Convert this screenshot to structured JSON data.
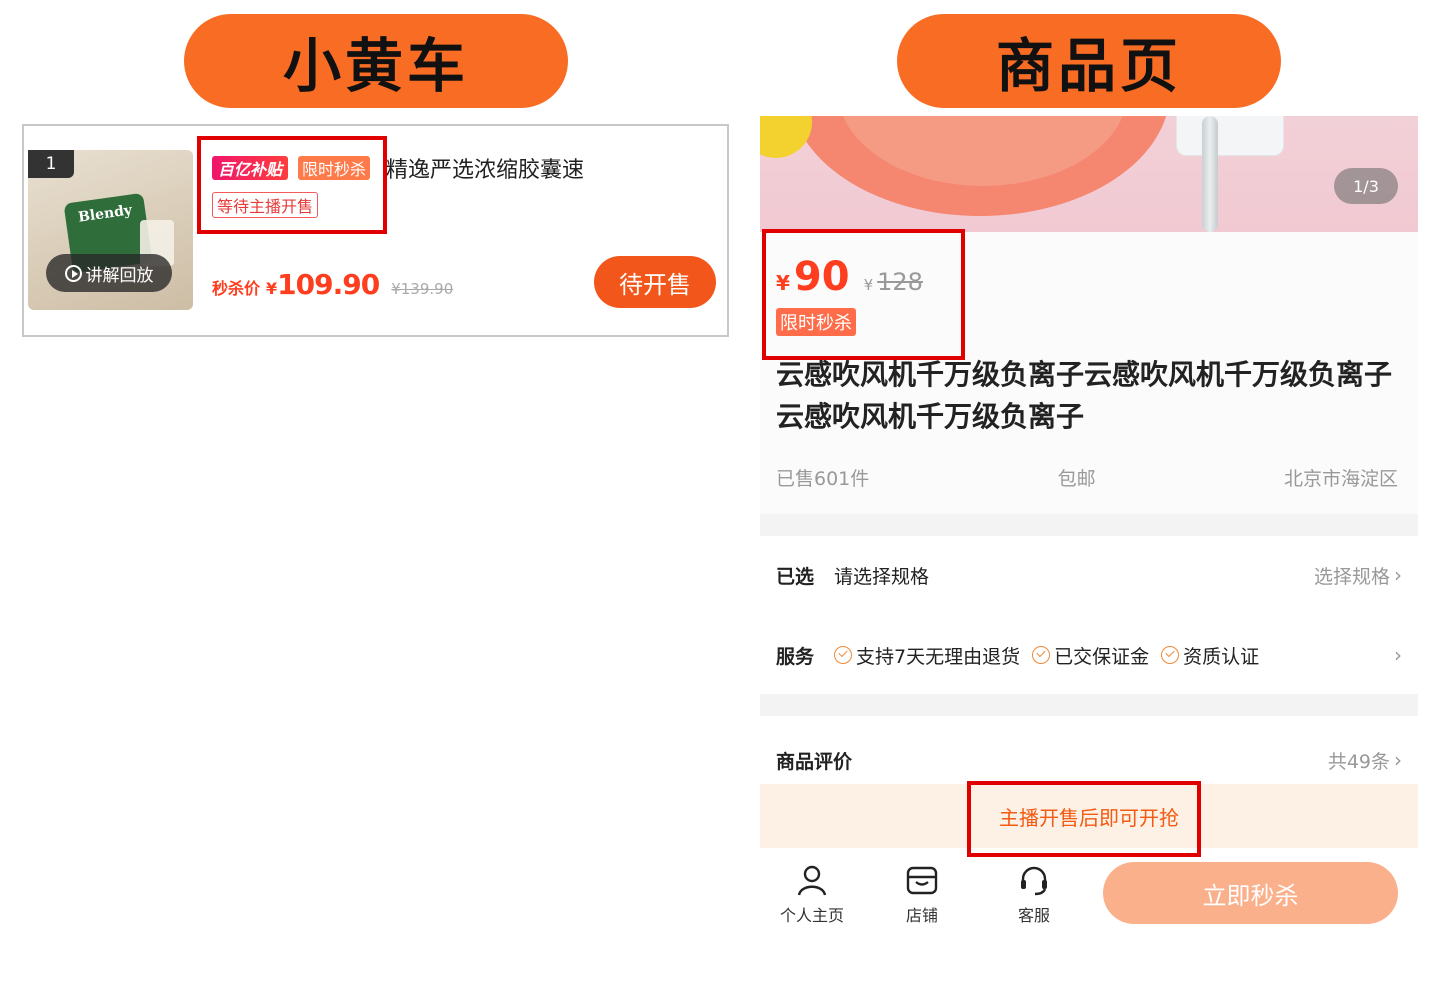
{
  "labels": {
    "left_title": "小黄车",
    "right_title": "商品页"
  },
  "cart_item": {
    "rank": "1",
    "thumb_text": "Blendy",
    "replay_label": "讲解回放",
    "tag_subsidy": "百亿补贴",
    "tag_flash": "限时秒杀",
    "title": "精逸严选浓缩胶囊速",
    "tag_status": "等待主播开售",
    "price_label": "秒杀价",
    "price_currency": "¥",
    "price": "109.90",
    "original_price": "¥139.90",
    "button": "待开售",
    "colors": {
      "accent": "#f3561a",
      "price": "#ff3d1f"
    }
  },
  "product_page": {
    "page_indicator": "1/3",
    "currency": "¥",
    "price": "90",
    "original_currency": "¥",
    "original_price": "128",
    "tag_flash": "限时秒杀",
    "title": "云感吹风机千万级负离子云感吹风机千万级负离子云感吹风机千万级负离子",
    "sold": "已售601件",
    "shipping": "包邮",
    "location": "北京市海淀区",
    "spec_label": "已选",
    "spec_value": "请选择规格",
    "spec_action": "选择规格",
    "service_label": "服务",
    "services": [
      "支持7天无理由退货",
      "已交保证金",
      "资质认证"
    ],
    "reviews_label": "商品评价",
    "reviews_count": "共49条",
    "notice": "主播开售后即可开抢",
    "nav": [
      {
        "label": "个人主页",
        "icon": "person-icon"
      },
      {
        "label": "店铺",
        "icon": "store-icon"
      },
      {
        "label": "客服",
        "icon": "headset-icon"
      }
    ],
    "buy_button": "立即秒杀",
    "colors": {
      "notice_bg": "#fdf1e6",
      "button_disabled": "#fbb08c"
    }
  },
  "highlight_color": "#e00000"
}
